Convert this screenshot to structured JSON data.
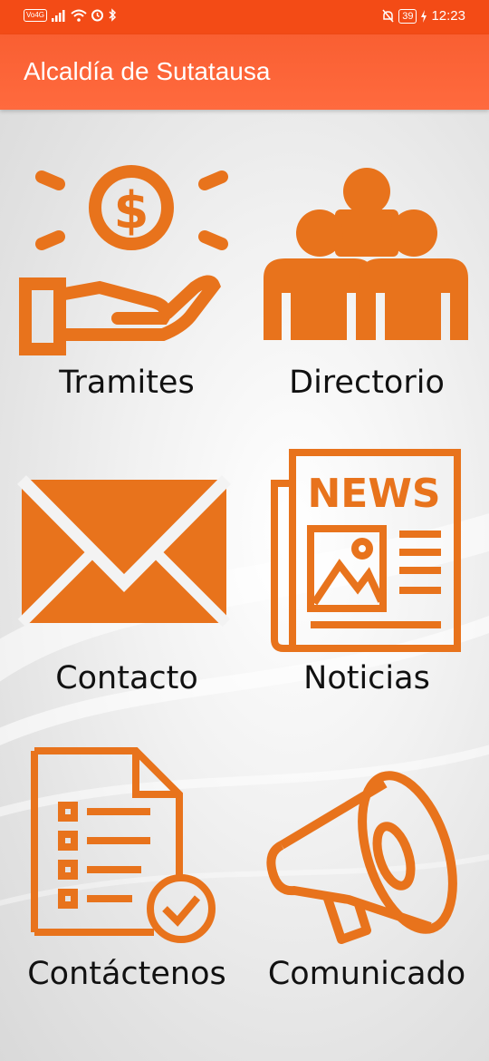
{
  "status_bar": {
    "network_badge": "Vo4G",
    "battery": "39",
    "time": "12:23",
    "icons": [
      "signal-icon",
      "wifi-icon",
      "alarm-icon",
      "bluetooth-icon",
      "mute-icon",
      "charging-icon"
    ]
  },
  "app": {
    "title": "Alcaldía de Sutatausa"
  },
  "colors": {
    "accent": "#e8731c",
    "status_bar": "#f34b16",
    "app_bar": "#ff6a3e"
  },
  "menu": [
    {
      "label": "Tramites",
      "icon": "money-hand-icon"
    },
    {
      "label": "Directorio",
      "icon": "people-icon"
    },
    {
      "label": "Contacto",
      "icon": "envelope-icon"
    },
    {
      "label": "Noticias",
      "icon": "newspaper-icon"
    },
    {
      "label": "Contáctenos",
      "icon": "checklist-document-icon"
    },
    {
      "label": "Comunicado",
      "icon": "megaphone-icon"
    }
  ],
  "icon_text": {
    "news": "NEWS"
  }
}
